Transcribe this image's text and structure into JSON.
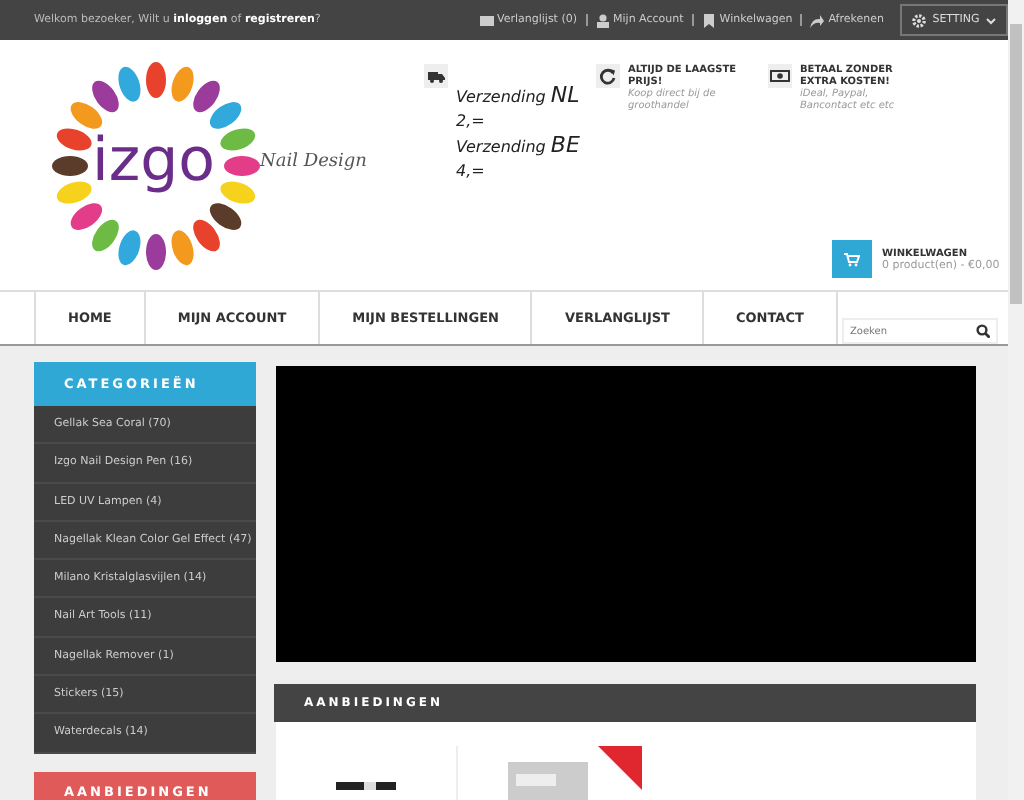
{
  "top_bar": {
    "welcome": "Welkom bezoeker, Wilt u **inloggen** of **registreren**?",
    "links": [
      {
        "kind": "wishlist",
        "label": "Verlanglijst (0)"
      },
      {
        "kind": "account",
        "label": "Mijn Account"
      },
      {
        "kind": "cart",
        "label": "Winkelwagen"
      },
      {
        "kind": "checkout",
        "label": "Afrekenen"
      }
    ],
    "setting": "SETTING"
  },
  "logo": {
    "name": "izgo",
    "tagline": "Nail Design"
  },
  "features": [
    {
      "kind": "truck",
      "lines": [
        "Verzending **NL**",
        "2,=",
        "Verzending **BE**",
        "4,="
      ]
    },
    {
      "kind": "refresh",
      "title": "ALTIJD DE LAAGSTE PRIJS!",
      "text": "Koop direct bij de groothandel"
    },
    {
      "kind": "money",
      "title": "BETAAL ZONDER EXTRA KOSTEN!",
      "text": "iDeal, Paypal, Bancontact etc etc"
    }
  ],
  "cart": {
    "title": "WINKELWAGEN",
    "summary": "0 product(en) - €0,00"
  },
  "nav": [
    {
      "label": "HOME"
    },
    {
      "label": "MIJN ACCOUNT"
    },
    {
      "label": "MIJN BESTELLINGEN"
    },
    {
      "label": "VERLANGLIJST"
    },
    {
      "label": "CONTACT"
    }
  ],
  "search": {
    "placeholder": "Zoeken"
  },
  "sidebar": {
    "title": "CATEGORIEËN",
    "items": [
      "Gellak Sea Coral (70)",
      "Izgo Nail Design Pen (16)",
      "LED UV Lampen (4)",
      "Nagellak Klean Color Gel Effect (47)",
      "Milano Kristalglasvijlen (14)",
      "Nail Art Tools (11)",
      "Nagellak Remover (1)",
      "Stickers (15)",
      "Waterdecals (14)"
    ],
    "offers_title": "AANBIEDINGEN"
  },
  "offers": {
    "title": "AANBIEDINGEN",
    "products": [
      {
        "kind": "picture",
        "sale": false
      },
      {
        "kind": "picture",
        "sale": true
      }
    ]
  }
}
